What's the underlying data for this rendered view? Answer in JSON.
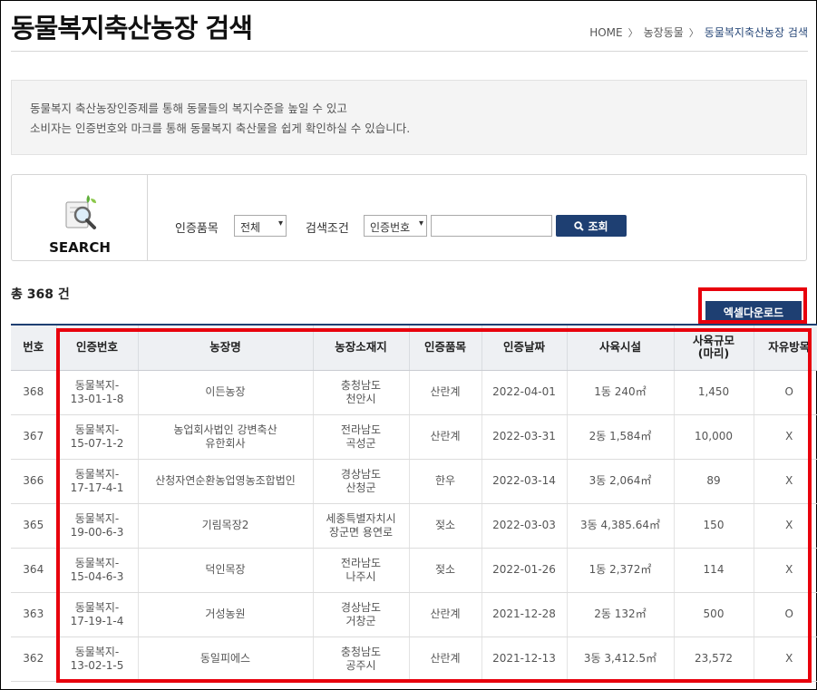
{
  "page": {
    "title": "동물복지축산농장 검색"
  },
  "breadcrumb": {
    "home": "HOME",
    "sep": "〉",
    "level1": "농장동물",
    "current": "동물복지축산농장 검색"
  },
  "info": {
    "line1": "동물복지 축산농장인증제를 통해 동물들의 복지수준을 높일 수 있고",
    "line2": "소비자는 인증번호와 마크를 통해 동물복지 축산물을 쉽게 확인하실 수 있습니다."
  },
  "search": {
    "label": "SEARCH",
    "item_label": "인증품목",
    "item_value": "전체",
    "condition_label": "검색조건",
    "condition_value": "인증번호",
    "keyword_value": "",
    "button_label": "조회"
  },
  "results": {
    "total_prefix": "총 ",
    "total_count": "368",
    "total_suffix": " 건",
    "excel_label": "엑셀다운로드"
  },
  "table": {
    "headers": [
      "번호",
      "인증번호",
      "농장명",
      "농장소재지",
      "인증품목",
      "인증날짜",
      "사육시설",
      "사육규모\n(마리)",
      "자유방목"
    ],
    "rows": [
      [
        "368",
        "동물복지-\n13-01-1-8",
        "이든농장",
        "충청남도\n천안시",
        "산란계",
        "2022-04-01",
        "1동 240㎡",
        "1,450",
        "O"
      ],
      [
        "367",
        "동물복지-\n15-07-1-2",
        "농업회사법인 강변축산\n유한회사",
        "전라남도\n곡성군",
        "산란계",
        "2022-03-31",
        "2동 1,584㎡",
        "10,000",
        "X"
      ],
      [
        "366",
        "동물복지-\n17-17-4-1",
        "산청자연순환농업영농조합법인",
        "경상남도\n산청군",
        "한우",
        "2022-03-14",
        "3동 2,064㎡",
        "89",
        "X"
      ],
      [
        "365",
        "동물복지-\n19-00-6-3",
        "기림목장2",
        "세종특별자치시\n장군면 용연로",
        "젖소",
        "2022-03-03",
        "3동 4,385.64㎡",
        "150",
        "X"
      ],
      [
        "364",
        "동물복지-\n15-04-6-3",
        "덕인목장",
        "전라남도\n나주시",
        "젖소",
        "2022-01-26",
        "1동 2,372㎡",
        "114",
        "X"
      ],
      [
        "363",
        "동물복지-\n17-19-1-4",
        "거성농원",
        "경상남도\n거창군",
        "산란계",
        "2021-12-28",
        "2동 132㎡",
        "500",
        "O"
      ],
      [
        "362",
        "동물복지-\n13-02-1-5",
        "동일피에스",
        "충청남도\n공주시",
        "산란계",
        "2021-12-13",
        "3동 3,412.5㎡",
        "23,572",
        "X"
      ]
    ]
  },
  "colors": {
    "primary": "#1e3f72",
    "highlight": "#e8000c",
    "info_bg": "#f4f4f4",
    "header_bg": "#eef0f3"
  }
}
